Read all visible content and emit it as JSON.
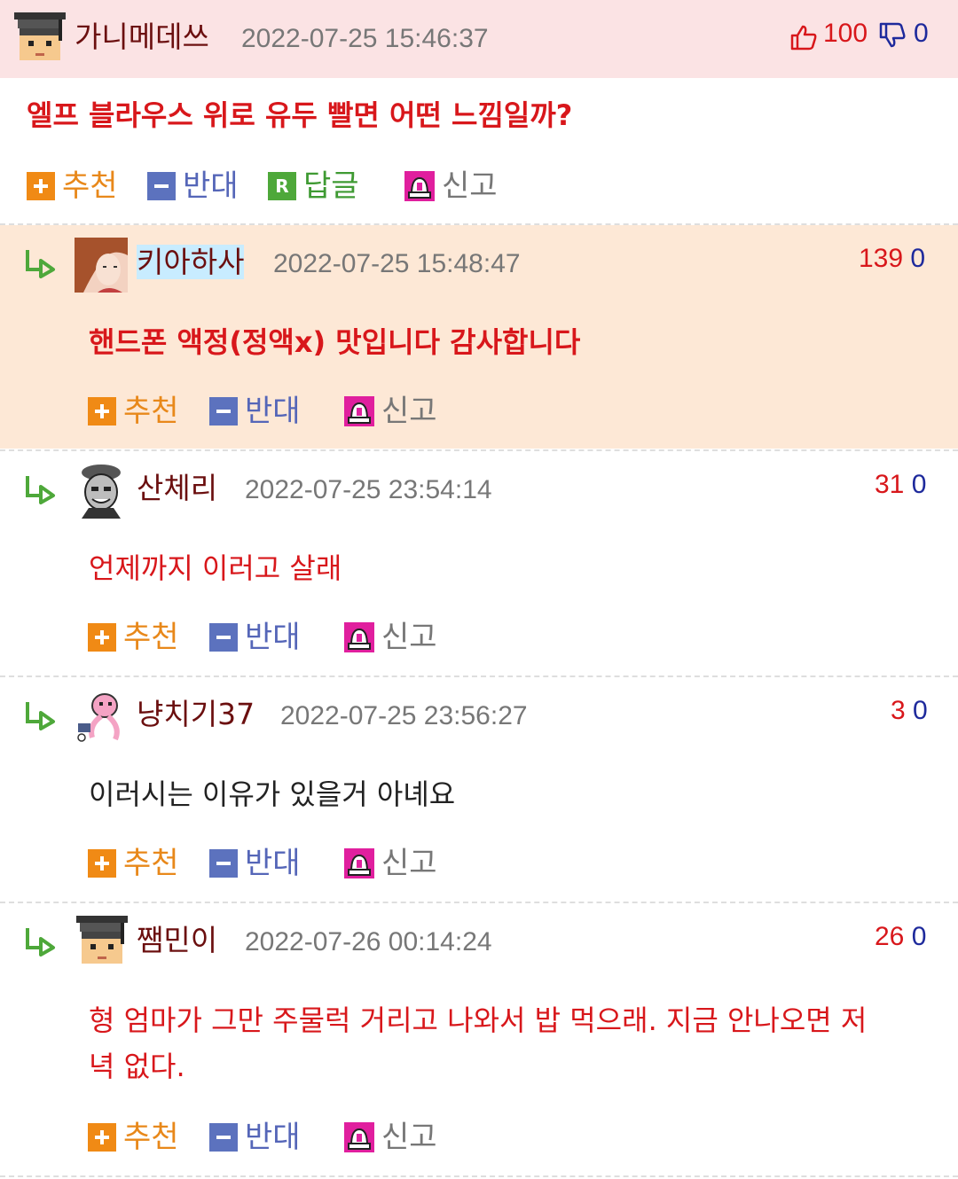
{
  "post": {
    "nick": "가니메데쓰",
    "date": "2022-07-25 15:46:37",
    "up_count": "100",
    "down_count": "0",
    "title": "엘프 블라우스 위로 유두 빨면 어떤 느낌일까?",
    "actions": {
      "recommend": "추천",
      "oppose": "반대",
      "reply_box": "R",
      "reply": "답글",
      "report": "신고"
    }
  },
  "comments": [
    {
      "nick": "키아하사",
      "date": "2022-07-25 15:48:47",
      "up": "139",
      "down": "0",
      "text": "핸드폰 액정(정액x) 맛입니다 감사합니다",
      "recommend": "추천",
      "oppose": "반대",
      "report": "신고"
    },
    {
      "nick": "산체리",
      "date": "2022-07-25 23:54:14",
      "up": "31",
      "down": "0",
      "text": "언제까지 이러고 살래",
      "recommend": "추천",
      "oppose": "반대",
      "report": "신고"
    },
    {
      "nick": "냥치기37",
      "date": "2022-07-25 23:56:27",
      "up": "3",
      "down": "0",
      "text": "이러시는 이유가 있을거 아녜요",
      "recommend": "추천",
      "oppose": "반대",
      "report": "신고"
    },
    {
      "nick": "쨈민이",
      "date": "2022-07-26 00:14:24",
      "up": "26",
      "down": "0",
      "text_line1": "형 엄마가 그만 주물럭 거리고 나와서 밥 먹으래. 지금 안나오면 저",
      "text_line2": "녁 없다.",
      "recommend": "추천",
      "oppose": "반대",
      "report": "신고"
    }
  ],
  "colors": {
    "header_bg": "#fbe3e4",
    "highlight_bg": "#fde8d6",
    "accent_red": "#d8171b",
    "accent_blue": "#1e2a9c"
  },
  "icons": [
    "student-avatar",
    "thumbs-up-icon",
    "thumbs-down-icon",
    "plus-icon",
    "minus-icon",
    "reply-icon",
    "siren-icon",
    "reply-arrow-icon"
  ]
}
